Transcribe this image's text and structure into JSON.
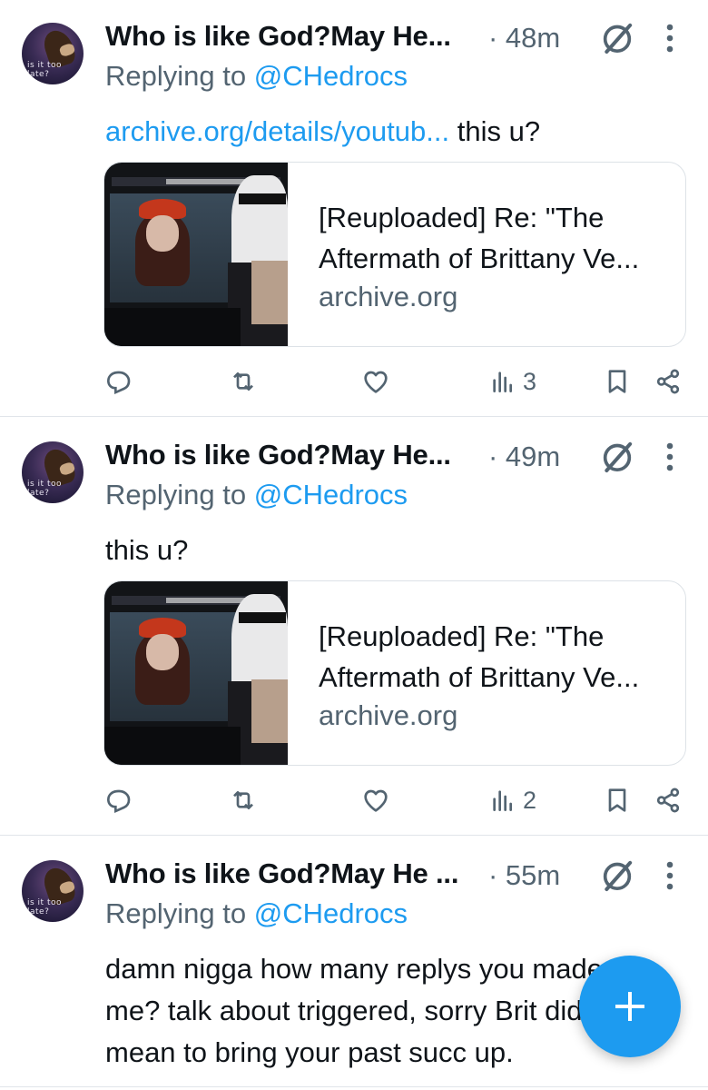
{
  "tweets": [
    {
      "author": {
        "name": "Who is like God?May He...",
        "avatar_text": "is it too late?"
      },
      "time": "· 48m",
      "reply_label": "Replying to ",
      "reply_handle": "@CHedrocs",
      "body_link": "archive.org/details/youtub...",
      "body_text": " this u?",
      "card": {
        "title": "[Reuploaded] Re: \"The Aftermath of Brittany Ve...",
        "domain": "archive.org"
      },
      "stats": {
        "views": "3"
      }
    },
    {
      "author": {
        "name": "Who is like God?May He...",
        "avatar_text": "is it too late?"
      },
      "time": "· 49m",
      "reply_label": "Replying to ",
      "reply_handle": "@CHedrocs",
      "body_link": "",
      "body_text": "this u?",
      "card": {
        "title": "[Reuploaded] Re: \"The Aftermath of Brittany Ve...",
        "domain": "archive.org"
      },
      "stats": {
        "views": "2"
      }
    },
    {
      "author": {
        "name": "Who is like God?May He ...",
        "avatar_text": "is it too late?"
      },
      "time": "· 55m",
      "reply_label": "Replying to ",
      "reply_handle": "@CHedrocs",
      "body_text": "damn nigga how many replys you made of me? talk about triggered, sorry Brit didn't mean to bring your past succ up."
    }
  ],
  "icons": {
    "reply": "reply-icon",
    "retweet": "retweet-icon",
    "like": "heart-icon",
    "views": "views-icon",
    "bookmark": "bookmark-icon",
    "share": "share-icon",
    "grok": "grok-icon",
    "more": "more-icon",
    "compose": "compose-plus-icon"
  },
  "colors": {
    "link": "#1d9bf0",
    "muted": "#536471",
    "text": "#0f1419",
    "fab": "#1d9bf0"
  }
}
